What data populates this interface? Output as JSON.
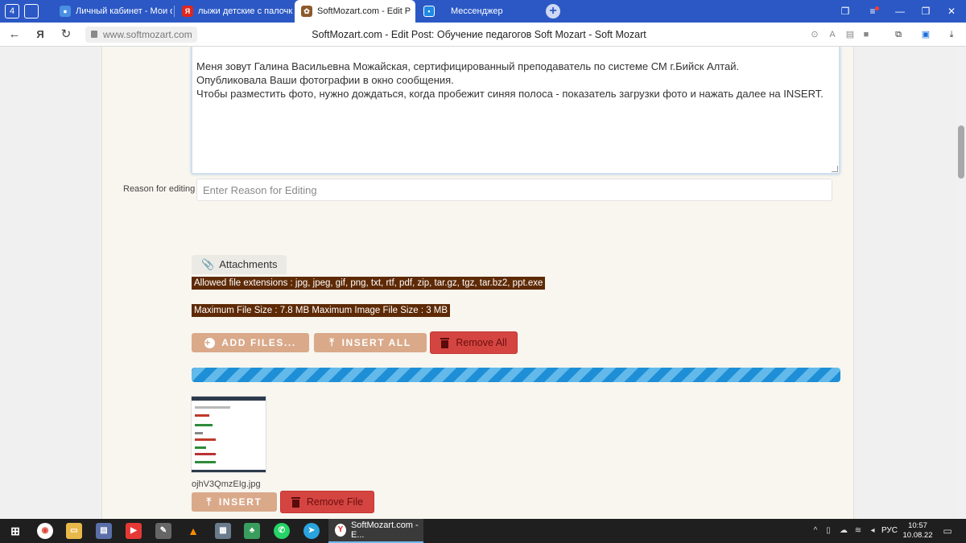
{
  "browser": {
    "tabs": [
      {
        "label": "Личный кабинет - Мои о",
        "active": false
      },
      {
        "label": "лыжи детские с палочкам",
        "active": false
      },
      {
        "label": "SoftMozart.com - Edit P",
        "active": true
      },
      {
        "label": "Мессенджер",
        "active": false
      }
    ],
    "tab_counter": "4",
    "url": "www.softmozart.com",
    "page_title": "SoftMozart.com - Edit Post: Обучение педагогов Soft Mozart - Soft Mozart"
  },
  "editor": {
    "message_lines": [
      "Меня зовут Галина Васильевна Можайская, сертифицированный преподаватель по системе СМ г.Бийск Алтай.",
      "Опубликовала Ваши фотографии в окно сообщения.",
      "Чтобы разместить фото, нужно дождаться, когда пробежит синяя полоса - показатель загрузки фото и нажать далее на INSERT."
    ],
    "reason_label": "Reason for editing",
    "reason_placeholder": "Enter Reason for Editing"
  },
  "attachments": {
    "tab_label": "Attachments",
    "allowed_extensions": "Allowed file extensions : jpg, jpeg, gif, png, txt, rtf, pdf, zip, tar.gz, tgz, tar.bz2, ppt.exe",
    "max_size": "Maximum File Size : 7.8 MB Maximum Image File Size : 3 MB",
    "add_files_label": "ADD FILES...",
    "insert_all_label": "INSERT ALL",
    "remove_all_label": "Remove All",
    "upload_progress": 1.0,
    "file_name": "ojhV3QmzEIg.jpg",
    "insert_label": "INSERT",
    "remove_file_label": "Remove File"
  },
  "taskbar": {
    "active_window": "SoftMozart.com - E...",
    "language": "РУС",
    "time": "10:57",
    "date": "10.08.22"
  },
  "colors": {
    "tabbar": "#2b58c5",
    "info_bar": "#5e2a06",
    "tan_button": "#d9a98a",
    "red_button": "#d44541",
    "progress": "#1e8fd6",
    "page_bg": "#f8f6ef"
  }
}
